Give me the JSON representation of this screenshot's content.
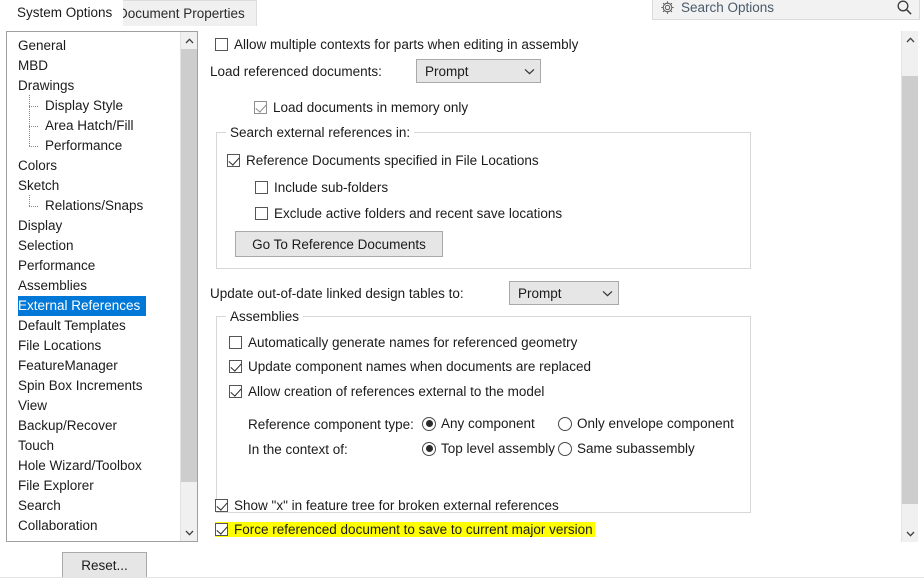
{
  "window": {
    "tabs": [
      {
        "label": "System Options",
        "active": true
      },
      {
        "label": "Document Properties",
        "active": false
      }
    ]
  },
  "search": {
    "placeholder": "Search Options",
    "gear_icon": "gear-icon",
    "magnifier_icon": "search-icon"
  },
  "sidebar": {
    "items": [
      {
        "label": "General",
        "level": 0,
        "selected": false
      },
      {
        "label": "MBD",
        "level": 0,
        "selected": false
      },
      {
        "label": "Drawings",
        "level": 0,
        "selected": false
      },
      {
        "label": "Display Style",
        "level": 1,
        "selected": false
      },
      {
        "label": "Area Hatch/Fill",
        "level": 1,
        "selected": false
      },
      {
        "label": "Performance",
        "level": 1,
        "selected": false,
        "last_child": true
      },
      {
        "label": "Colors",
        "level": 0,
        "selected": false
      },
      {
        "label": "Sketch",
        "level": 0,
        "selected": false
      },
      {
        "label": "Relations/Snaps",
        "level": 1,
        "selected": false,
        "last_child": true
      },
      {
        "label": "Display",
        "level": 0,
        "selected": false
      },
      {
        "label": "Selection",
        "level": 0,
        "selected": false
      },
      {
        "label": "Performance",
        "level": 0,
        "selected": false
      },
      {
        "label": "Assemblies",
        "level": 0,
        "selected": false
      },
      {
        "label": "External References",
        "level": 0,
        "selected": true
      },
      {
        "label": "Default Templates",
        "level": 0,
        "selected": false
      },
      {
        "label": "File Locations",
        "level": 0,
        "selected": false
      },
      {
        "label": "FeatureManager",
        "level": 0,
        "selected": false
      },
      {
        "label": "Spin Box Increments",
        "level": 0,
        "selected": false
      },
      {
        "label": "View",
        "level": 0,
        "selected": false
      },
      {
        "label": "Backup/Recover",
        "level": 0,
        "selected": false
      },
      {
        "label": "Touch",
        "level": 0,
        "selected": false
      },
      {
        "label": "Hole Wizard/Toolbox",
        "level": 0,
        "selected": false
      },
      {
        "label": "File Explorer",
        "level": 0,
        "selected": false
      },
      {
        "label": "Search",
        "level": 0,
        "selected": false
      },
      {
        "label": "Collaboration",
        "level": 0,
        "selected": false
      }
    ],
    "selection_color": "#0078d7"
  },
  "main": {
    "allow_multiple_contexts": {
      "label": "Allow multiple contexts for parts when editing in assembly",
      "checked": false
    },
    "load_referenced_documents": {
      "label": "Load referenced documents:",
      "value": "Prompt"
    },
    "load_in_memory_only": {
      "label": "Load documents in memory only",
      "checked": true,
      "disabled": true
    },
    "search_external_refs": {
      "caption": "Search external references in:",
      "reference_documents": {
        "label": "Reference Documents specified in File Locations",
        "checked": true
      },
      "include_subfolders": {
        "label": "Include sub-folders",
        "checked": false
      },
      "exclude_active_folders": {
        "label": "Exclude active folders and recent save locations",
        "checked": false
      },
      "go_to_button": "Go To Reference Documents"
    },
    "update_linked_design_tables": {
      "label": "Update out-of-date linked design tables to:",
      "value": "Prompt"
    },
    "assemblies": {
      "caption": "Assemblies",
      "auto_generate_names": {
        "label": "Automatically generate names for referenced geometry",
        "checked": false
      },
      "update_component_names": {
        "label": "Update component names when documents are replaced",
        "checked": true
      },
      "allow_external_refs": {
        "label": "Allow creation of references external to the model",
        "checked": true
      },
      "reference_component_type": {
        "label": "Reference component type:",
        "options": [
          {
            "label": "Any component",
            "selected": true
          },
          {
            "label": "Only envelope component",
            "selected": false
          }
        ]
      },
      "in_the_context_of": {
        "label": "In the context of:",
        "options": [
          {
            "label": "Top level assembly",
            "selected": true
          },
          {
            "label": "Same subassembly",
            "selected": false
          }
        ]
      }
    },
    "show_x_broken_refs": {
      "label": "Show \"x\" in feature tree for broken external references",
      "checked": true
    },
    "force_save_major_version": {
      "label": "Force referenced document to save to current major version",
      "checked": true,
      "highlighted": true,
      "highlight_color": "#ffff00"
    }
  },
  "footer": {
    "reset_button": "Reset..."
  }
}
